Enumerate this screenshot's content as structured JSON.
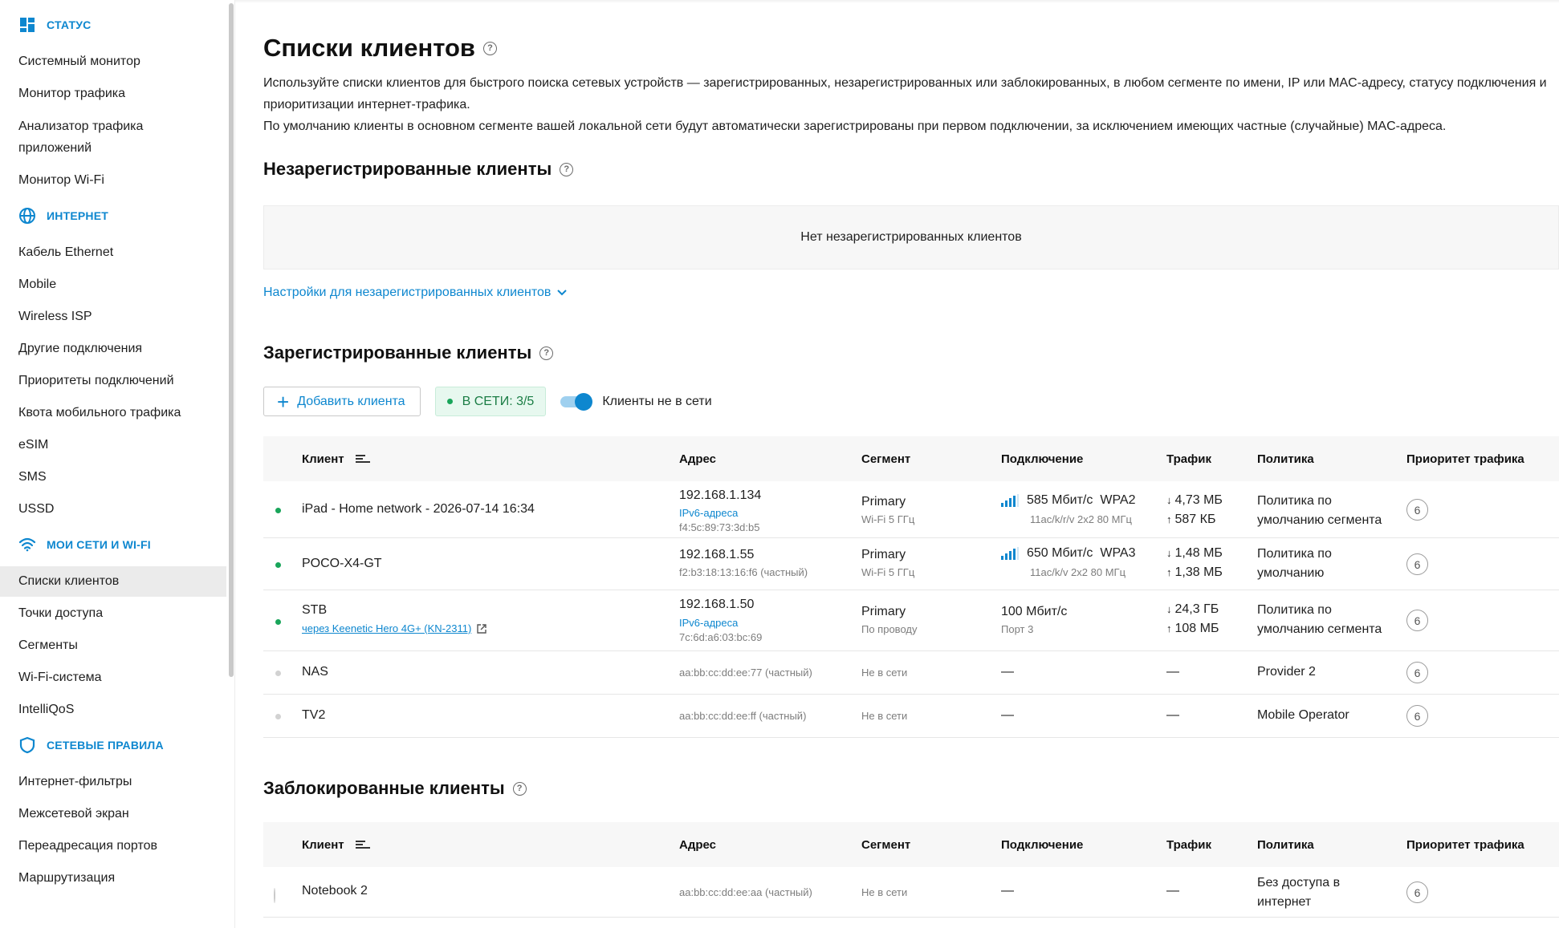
{
  "sidebar": {
    "sections": [
      {
        "title": "СТАТУС",
        "icon": "dashboard-icon",
        "items": [
          "Системный монитор",
          "Монитор трафика",
          "Анализатор трафика приложений",
          "Монитор Wi-Fi"
        ]
      },
      {
        "title": "ИНТЕРНЕТ",
        "icon": "globe-icon",
        "items": [
          "Кабель Ethernet",
          "Mobile",
          "Wireless ISP",
          "Другие подключения",
          "Приоритеты подключений",
          "Квота мобильного трафика",
          "eSIM",
          "SMS",
          "USSD"
        ]
      },
      {
        "title": "МОИ СЕТИ И WI-FI",
        "icon": "wifi-icon",
        "items": [
          "Списки клиентов",
          "Точки доступа",
          "Сегменты",
          "Wi-Fi-система",
          "IntelliQoS"
        ]
      },
      {
        "title": "СЕТЕВЫЕ ПРАВИЛА",
        "icon": "shield-icon",
        "items": [
          "Интернет-фильтры",
          "Межсетевой экран",
          "Переадресация портов",
          "Маршрутизация"
        ]
      }
    ],
    "active_item": "Списки клиентов"
  },
  "page": {
    "title": "Списки клиентов",
    "description_1": "Используйте списки клиентов для быстрого поиска сетевых устройств — зарегистрированных, незарегистрированных или заблокированных, в любом сегменте по имени, IP или MAC-адресу, статусу подключения и приоритизации интернет-трафика.",
    "description_2": "По умолчанию клиенты в основном сегменте вашей локальной сети будут автоматически зарегистрированы при первом подключении, за исключением имеющих частные (случайные) MAC-адреса."
  },
  "unregistered": {
    "title": "Незарегистрированные клиенты",
    "empty_text": "Нет незарегистрированных клиентов",
    "settings_link": "Настройки для незарегистрированных клиентов"
  },
  "registered": {
    "title": "Зарегистрированные клиенты",
    "add_button": "Добавить клиента",
    "online_badge": "В СЕТИ: 3/5",
    "toggle_label": "Клиенты не в сети",
    "toggle_on": true
  },
  "columns": {
    "client": "Клиент",
    "address": "Адрес",
    "segment": "Сегмент",
    "connection": "Подключение",
    "traffic": "Трафик",
    "policy": "Политика",
    "priority": "Приоритет трафика"
  },
  "clients": [
    {
      "status": "online",
      "name": "iPad - Home network - 2026-07-14 16:34",
      "ip": "192.168.1.134",
      "ipv6_link": "IPv6-адреса",
      "mac": "f4:5c:89:73:3d:b5",
      "segment": "Primary",
      "segment_sub": "Wi-Fi 5 ГГц",
      "speed": "585 Мбит/с",
      "security": "WPA2",
      "conn_sub": "11ac/k/r/v 2x2 80 МГц",
      "down": "4,73 МБ",
      "up": "587 КБ",
      "policy": "Политика по умолчанию сегмента",
      "priority": "6"
    },
    {
      "status": "online",
      "name": "POCO-X4-GT",
      "ip": "192.168.1.55",
      "mac": "f2:b3:18:13:16:f6 (частный)",
      "segment": "Primary",
      "segment_sub": "Wi-Fi 5 ГГц",
      "speed": "650 Мбит/с",
      "security": "WPA3",
      "conn_sub": "11ac/k/v 2x2 80 МГц",
      "down": "1,48 МБ",
      "up": "1,38 МБ",
      "policy": "Политика по умолчанию",
      "priority": "6"
    },
    {
      "status": "online",
      "name": "STB",
      "via": "через Keenetic Hero 4G+ (KN-2311)",
      "ip": "192.168.1.50",
      "ipv6_link": "IPv6-адреса",
      "mac": "7c:6d:a6:03:bc:69",
      "segment": "Primary",
      "segment_sub": "По проводу",
      "speed": "100 Мбит/с",
      "conn_sub": "Порт 3",
      "down": "24,3 ГБ",
      "up": "108 МБ",
      "policy": "Политика по умолчанию сегмента",
      "priority": "6"
    },
    {
      "status": "offline",
      "name": "NAS",
      "mac": "aa:bb:cc:dd:ee:77 (частный)",
      "segment_sub": "Не в сети",
      "conn": "—",
      "traffic": "—",
      "policy": "Provider 2",
      "priority": "6"
    },
    {
      "status": "offline",
      "name": "TV2",
      "mac": "aa:bb:cc:dd:ee:ff (частный)",
      "segment_sub": "Не в сети",
      "conn": "—",
      "traffic": "—",
      "policy": "Mobile Operator",
      "priority": "6"
    }
  ],
  "blocked": {
    "title": "Заблокированные клиенты",
    "clients": [
      {
        "name": "Notebook 2",
        "mac": "aa:bb:cc:dd:ee:aa (частный)",
        "segment_sub": "Не в сети",
        "conn": "—",
        "traffic": "—",
        "policy": "Без доступа в интернет",
        "priority": "6"
      }
    ]
  },
  "colors": {
    "accent": "#0e87cf",
    "online": "#19a55a",
    "badge_bg": "#e7f8ef"
  }
}
